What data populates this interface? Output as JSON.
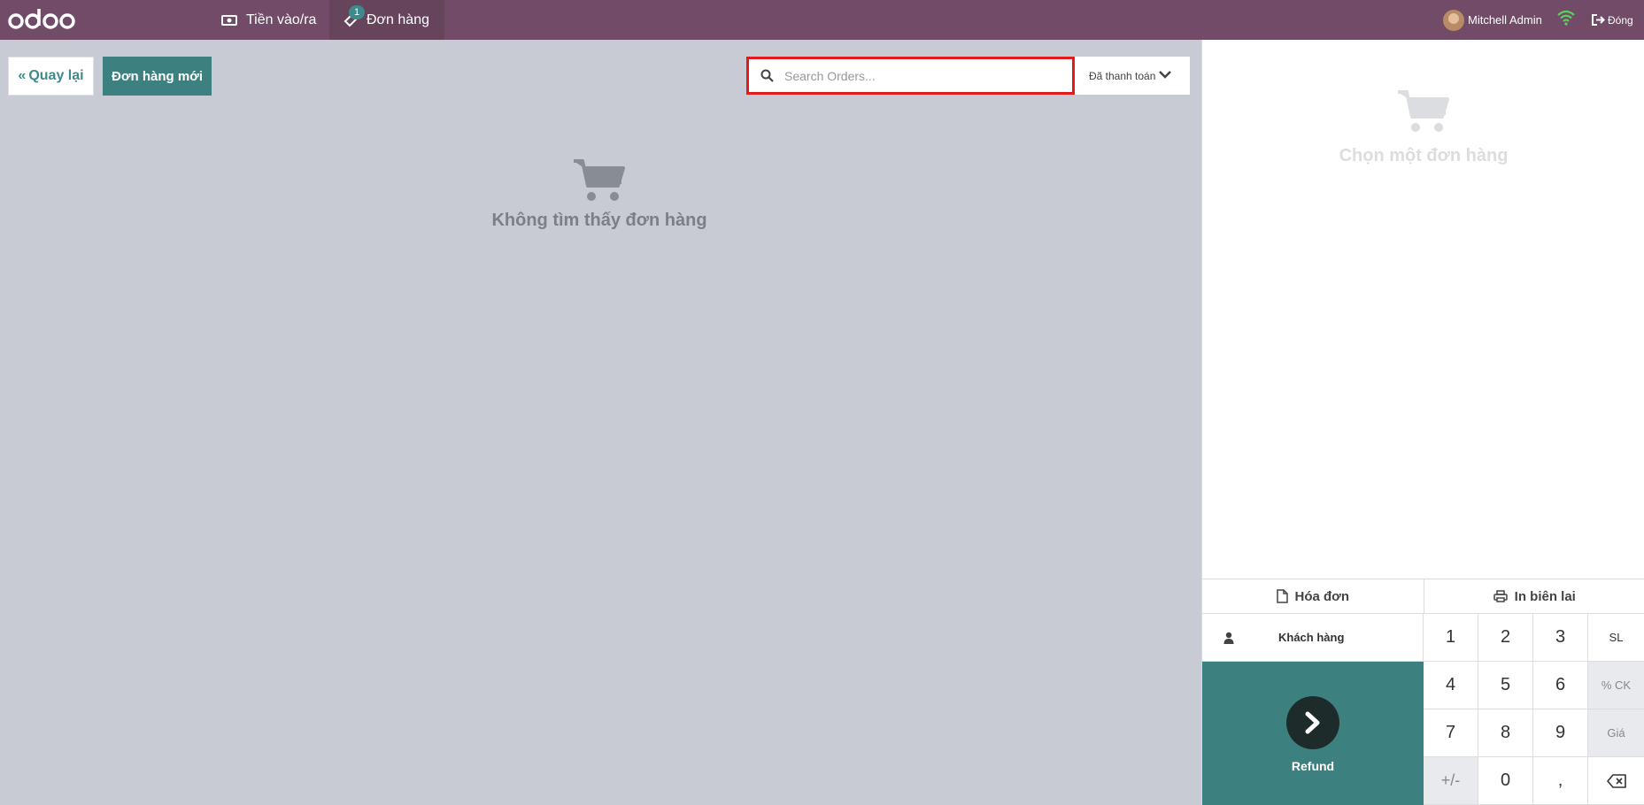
{
  "nav": {
    "cash_label": "Tiền vào/ra",
    "orders_label": "Đơn hàng",
    "orders_badge": "1",
    "user_name": "Mitchell Admin",
    "close_label": "Đóng"
  },
  "toolbar": {
    "back_label": "Quay lại",
    "new_order_label": "Đơn hàng mới",
    "search_placeholder": "Search Orders...",
    "filter_label": "Đã thanh toán"
  },
  "empty_state": {
    "message": "Không tìm thấy đơn hàng"
  },
  "right_panel": {
    "select_message": "Chọn một đơn hàng",
    "invoice_label": "Hóa đơn",
    "reprint_label": "In biên lai",
    "customer_label": "Khách hàng",
    "refund_label": "Refund"
  },
  "numpad": {
    "keys": [
      "1",
      "2",
      "3",
      "SL",
      "4",
      "5",
      "6",
      "% CK",
      "7",
      "8",
      "9",
      "Giá",
      "+/-",
      "0",
      ",",
      "backspace"
    ]
  },
  "colors": {
    "navbar": "#714b67",
    "accent": "#3d8080",
    "search_highlight": "#e01b1b",
    "background": "#c8cbd3"
  }
}
